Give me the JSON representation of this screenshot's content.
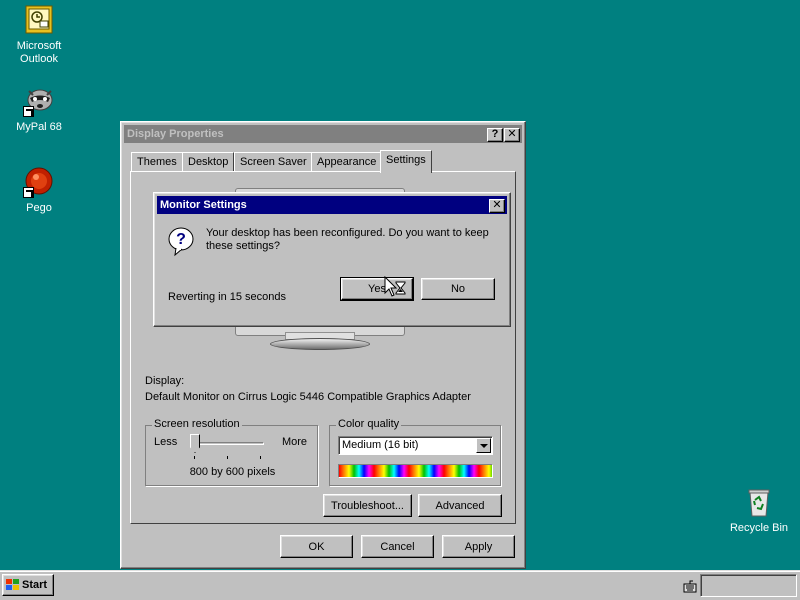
{
  "desktop": {
    "icons": [
      {
        "label": "Microsoft Outlook",
        "icon": "outlook-icon"
      },
      {
        "label": "MyPal 68",
        "icon": "raccoon-icon"
      },
      {
        "label": "Pego",
        "icon": "pego-icon"
      },
      {
        "label": "Recycle Bin",
        "icon": "recycle-bin-icon"
      }
    ],
    "background_color": "#008080"
  },
  "display_properties": {
    "title": "Display Properties",
    "tabs": [
      "Themes",
      "Desktop",
      "Screen Saver",
      "Appearance",
      "Settings"
    ],
    "active_tab": "Settings",
    "display_label": "Display:",
    "display_value": "Default Monitor on Cirrus Logic 5446 Compatible Graphics Adapter",
    "screen_resolution": {
      "legend": "Screen resolution",
      "less": "Less",
      "more": "More",
      "value_text": "800 by 600 pixels",
      "slider_position": 0.0
    },
    "color_quality": {
      "legend": "Color quality",
      "selected": "Medium (16 bit)"
    },
    "buttons": {
      "troubleshoot": "Troubleshoot...",
      "advanced": "Advanced",
      "ok": "OK",
      "cancel": "Cancel",
      "apply": "Apply"
    },
    "title_bar_color": "#808080"
  },
  "monitor_settings": {
    "title": "Monitor Settings",
    "message": "Your desktop has been reconfigured.  Do you want to keep these settings?",
    "countdown": "Reverting in 15 seconds",
    "yes": "Yes",
    "no": "No",
    "title_bar_color": "#000080"
  },
  "taskbar": {
    "start": "Start"
  }
}
